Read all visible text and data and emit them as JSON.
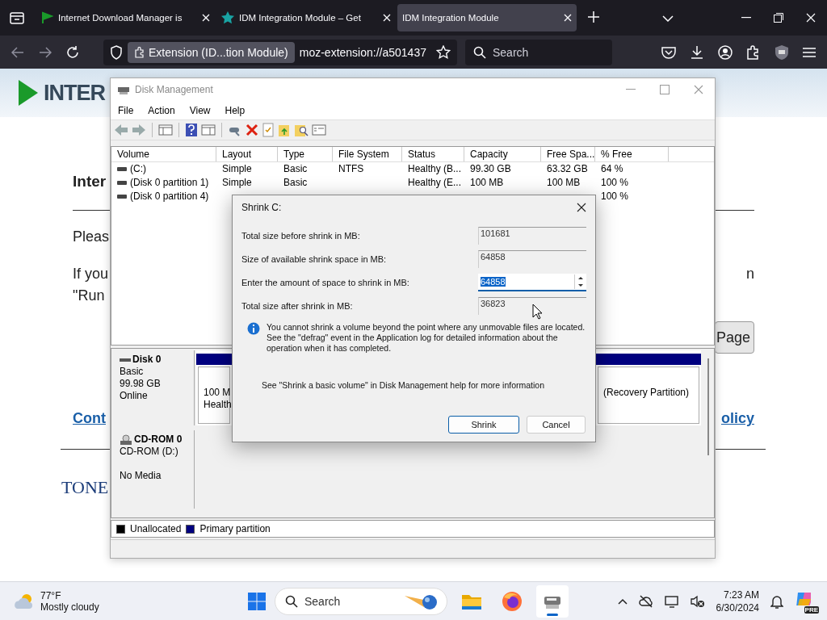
{
  "browser": {
    "tabs": [
      {
        "title": "Internet Download Manager is",
        "kind": "flag",
        "selected": false
      },
      {
        "title": "IDM Integration Module – Get",
        "kind": "star",
        "selected": false
      },
      {
        "title": "IDM Integration Module",
        "kind": "plain",
        "selected": true
      }
    ],
    "identity_chip": "Extension (ID...tion Module)",
    "url": "moz-extension://a501437",
    "search": {
      "placeholder": "Search"
    }
  },
  "web_page": {
    "logo": "INTER",
    "heading": "Inter",
    "paragraph_1": "Pleas",
    "paragraph_2_lines": [
      "If you",
      "\"Run"
    ],
    "paragraph_2_right": "n",
    "button": "Page",
    "link_left": "Cont",
    "link_right": "olicy",
    "footer_logo": "TONE"
  },
  "disk_management": {
    "title": "Disk Management",
    "menu": [
      "File",
      "Action",
      "View",
      "Help"
    ],
    "columns": [
      "Volume",
      "Layout",
      "Type",
      "File System",
      "Status",
      "Capacity",
      "Free Spa...",
      "% Free"
    ],
    "rows": [
      {
        "volume": "(C:)",
        "layout": "Simple",
        "type": "Basic",
        "file_system": "NTFS",
        "status": "Healthy (B...",
        "capacity": "99.30 GB",
        "free_space": "63.32 GB",
        "pct_free": "64 %"
      },
      {
        "volume": "(Disk 0 partition 1)",
        "layout": "Simple",
        "type": "Basic",
        "status": "Healthy (E...",
        "capacity": "100 MB",
        "free_space": "100 MB",
        "pct_free": "100 %"
      },
      {
        "volume": "(Disk 0 partition 4)",
        "pct_free": "100 %"
      }
    ],
    "disks": [
      {
        "kind": "disk",
        "name": "Disk 0",
        "type": "Basic",
        "size": "99.98 GB",
        "status": "Online",
        "partitions": [
          {
            "lines": [
              "100 M",
              "Health"
            ]
          },
          {
            "lines": [
              "(Recovery Partition)"
            ]
          }
        ]
      },
      {
        "kind": "cdrom",
        "name": "CD-ROM 0",
        "type": "CD-ROM (D:)",
        "status": "No Media"
      }
    ],
    "legend": [
      {
        "label": "Unallocated",
        "color": "#000000"
      },
      {
        "label": "Primary partition",
        "color": "#00007f"
      }
    ]
  },
  "dialog": {
    "title": "Shrink C:",
    "fields": [
      {
        "label": "Total size before shrink in MB:",
        "value": "101681",
        "kind": "readonly",
        "selected": false
      },
      {
        "label": "Size of available shrink space in MB:",
        "value": "64858",
        "kind": "readonly",
        "selected": false
      },
      {
        "label": "Enter the amount of space to shrink in MB:",
        "value": "64858",
        "kind": "spin",
        "selected": true
      },
      {
        "label": "Total size after shrink in MB:",
        "value": "36823",
        "kind": "readonly",
        "selected": false
      }
    ],
    "info_lines": [
      "You cannot shrink a volume beyond the point where any unmovable files are located.",
      "See the \"defrag\" event in the Application log for detailed information about the",
      "operation when it has completed."
    ],
    "help_text": "See \"Shrink a basic volume\" in Disk Management help for more information",
    "buttons": [
      {
        "label": "Shrink",
        "default": true
      },
      {
        "label": "Cancel",
        "default": false
      }
    ]
  },
  "taskbar": {
    "weather": {
      "temp": "77°F",
      "condition": "Mostly cloudy"
    },
    "search": {
      "placeholder": "Search"
    },
    "apps": [
      {
        "kind": "files",
        "active": false
      },
      {
        "kind": "firefox",
        "active": false
      },
      {
        "kind": "disk",
        "active": true
      }
    ],
    "clock": {
      "time": "7:23 AM",
      "date": "6/30/2024"
    },
    "copilot_badge": "PRE"
  }
}
